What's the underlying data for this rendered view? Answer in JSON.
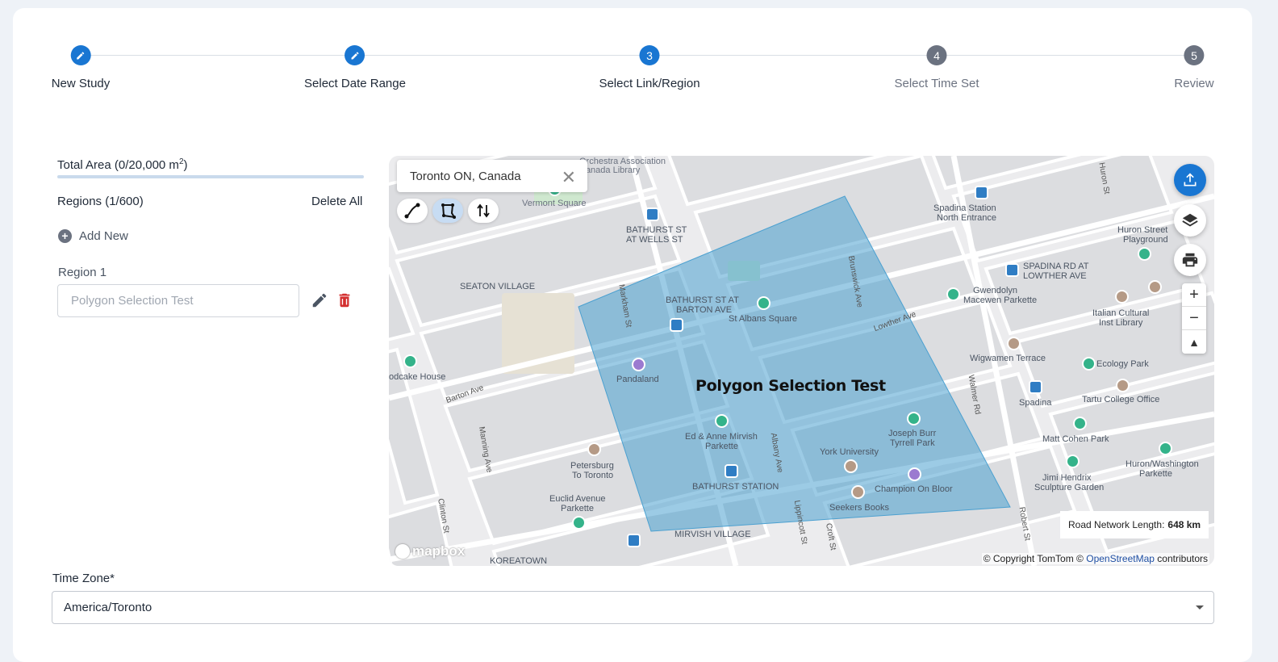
{
  "stepper": {
    "steps": [
      {
        "number": "1",
        "label": "New Study",
        "state": "done",
        "icon": "pencil-icon"
      },
      {
        "number": "2",
        "label": "Select Date Range",
        "state": "done",
        "icon": "pencil-icon"
      },
      {
        "number": "3",
        "label": "Select Link/Region",
        "state": "active"
      },
      {
        "number": "4",
        "label": "Select Time Set",
        "state": "todo"
      },
      {
        "number": "5",
        "label": "Review",
        "state": "todo"
      }
    ]
  },
  "panel": {
    "total_area_text": "Total Area (0/20,000 m",
    "total_area_sup": "2",
    "total_area_close": ")",
    "regions_label": "Regions (1/600)",
    "delete_all": "Delete All",
    "add_new": "Add New",
    "region": {
      "label": "Region 1",
      "placeholder": "Polygon Selection Test"
    }
  },
  "map": {
    "search_value": "Toronto ON, Canada",
    "polygon_label": "Polygon Selection Test",
    "road_length_label": "Road Network Length:",
    "road_length_value": "648 km",
    "copyright_prefix": "© Copyright TomTom ©",
    "copyright_link": "OpenStreetMap",
    "copyright_suffix": "contributors",
    "logo": "mapbox",
    "labels": [
      "Orchestra Association",
      "Canada Library",
      "Vermont Square",
      "BATHURST ST",
      "AT WELLS ST",
      "SEATON VILLAGE",
      "BATHURST ST AT",
      "BARTON AVE",
      "St Albans Square",
      "Pandaland",
      "Ed & Anne Mirvish",
      "Parkette",
      "Joseph Burr",
      "Tyrrell Park",
      "York University",
      "BATHURST STATION",
      "Champion On Bloor",
      "Seekers Books",
      "MIRVISH VILLAGE",
      "KOREATOWN",
      "Petersburg",
      "To Toronto",
      "Euclid Avenue",
      "Parkette",
      "odcake House",
      "Spadina Station",
      "North Entrance",
      "Huron Street",
      "Playground",
      "SPADINA RD AT",
      "LOWTHER AVE",
      "Gwendolyn",
      "Macewen Parkette",
      "Italian Cultural",
      "Inst Library",
      "Wigwamen Terrace",
      "Ecology Park",
      "Spadina",
      "Tartu College Office",
      "Matt Cohen Park",
      "Jimi Hendrix",
      "Sculpture Garden",
      "Huron/Washington",
      "Parkette",
      "Markham St",
      "Brunswick Ave",
      "Lowther Ave",
      "Barton Ave",
      "Manning Ave",
      "Albany Ave",
      "Clinton St",
      "Lippincott St",
      "Croft St",
      "Walmer Rd",
      "Robert St",
      "Huron St"
    ]
  },
  "timezone": {
    "label": "Time Zone*",
    "value": "America/Toronto"
  }
}
